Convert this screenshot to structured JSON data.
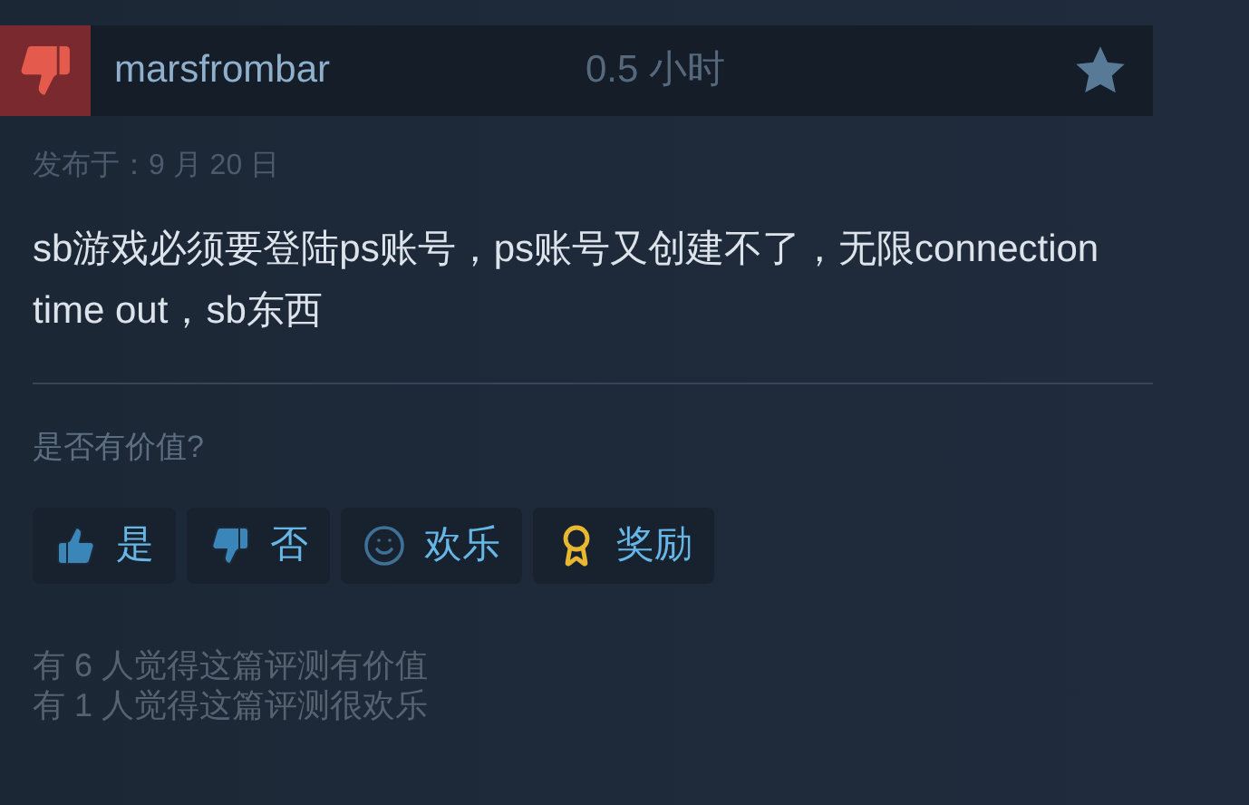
{
  "review": {
    "recommended": false,
    "author": "marsfrombar",
    "hours": "0.5 小时",
    "posted": "发布于：9 月 20 日",
    "text": "sb游戏必须要登陆ps账号，ps账号又创建不了，无限connection time out，sb东西"
  },
  "helpful": {
    "question": "是否有价值?",
    "buttons": [
      {
        "kind": "yes",
        "label": "是"
      },
      {
        "kind": "no",
        "label": "否"
      },
      {
        "kind": "funny",
        "label": "欢乐"
      },
      {
        "kind": "award",
        "label": "奖励"
      }
    ]
  },
  "counts": [
    "有 6 人觉得这篇评测有价值",
    "有 1 人觉得这篇评测很欢乐"
  ]
}
